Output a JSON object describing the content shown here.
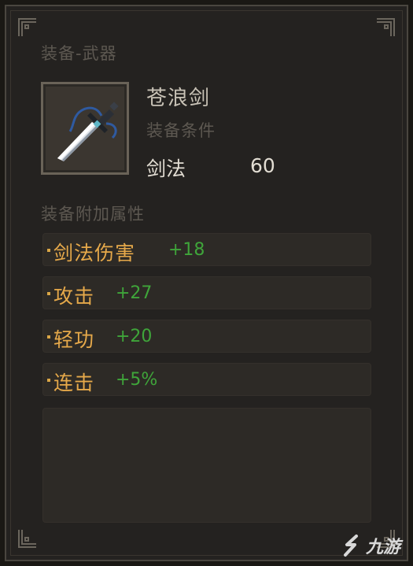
{
  "panel": {
    "category_title": "装备-武器",
    "item": {
      "name": "苍浪剑",
      "icon": "sword-icon",
      "requirement_label": "装备条件",
      "requirement_skill": "剑法",
      "requirement_value": "60"
    },
    "attributes_title": "装备附加属性",
    "attributes": [
      {
        "name": "剑法伤害",
        "value": "+18"
      },
      {
        "name": "攻击",
        "value": "+27"
      },
      {
        "name": "轻功",
        "value": "+20"
      },
      {
        "name": "连击",
        "value": "+5%"
      }
    ]
  },
  "watermark": {
    "text": "九游",
    "logo": "jiuyou-logo"
  },
  "colors": {
    "panel_bg": "#242220",
    "attr_name": "#e6a94a",
    "attr_value": "#3fa53a",
    "muted_label": "#5d5851"
  }
}
